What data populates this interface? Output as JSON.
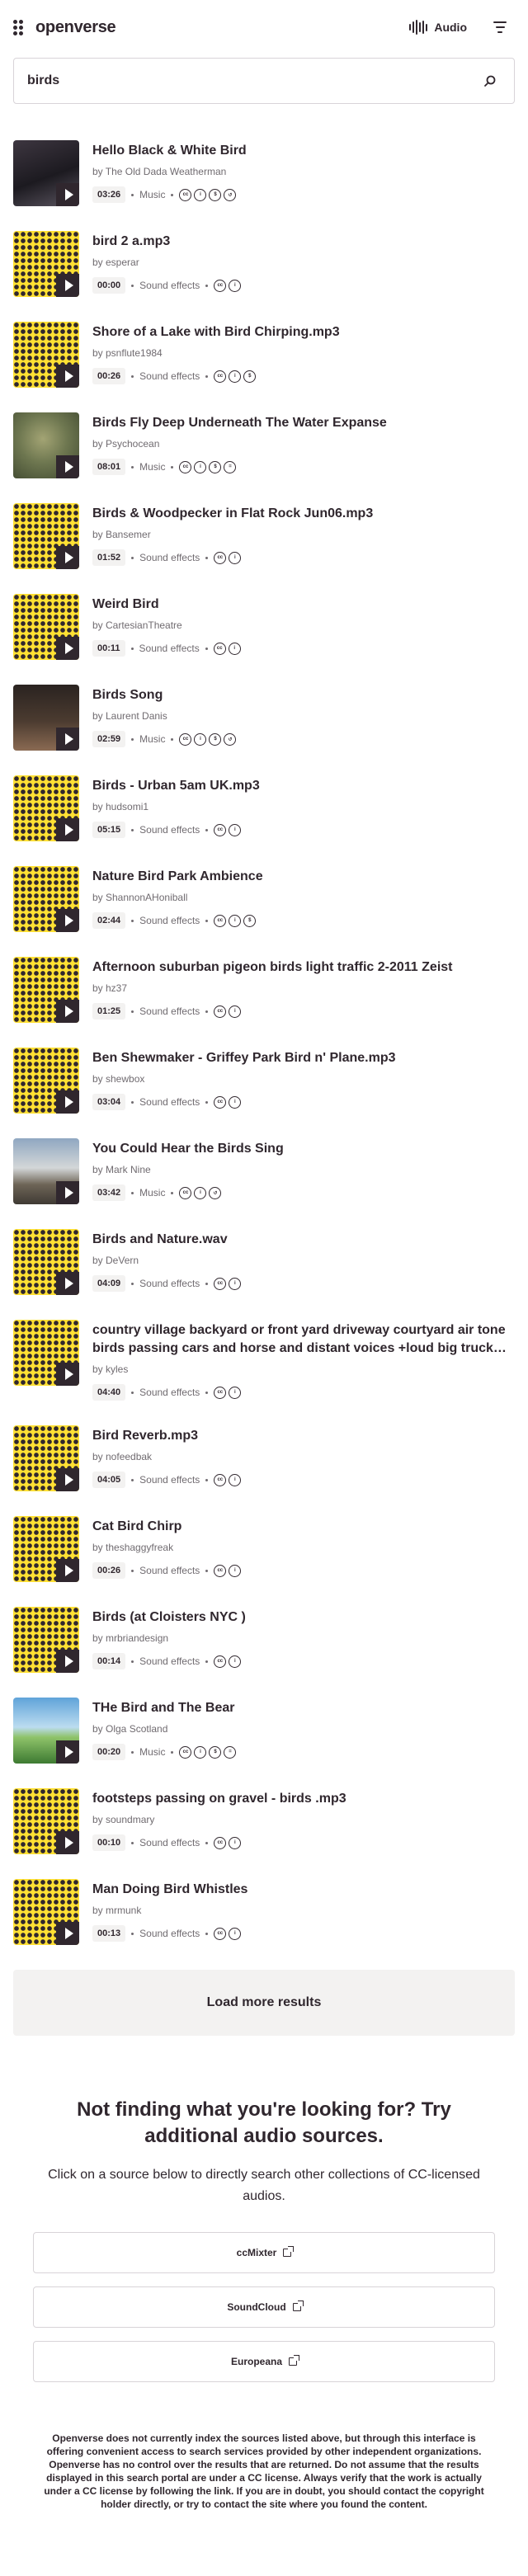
{
  "header": {
    "brand": "openverse",
    "content_type": "Audio"
  },
  "search": {
    "query": "birds"
  },
  "results": [
    {
      "title": "Hello Black & White Bird",
      "creator": "by The Old Dada Weatherman",
      "duration": "03:26",
      "category": "Music",
      "licenses": [
        "cc",
        "by",
        "nc",
        "sa"
      ],
      "thumb": "photo-dark"
    },
    {
      "title": "bird 2 a.mp3",
      "creator": "by esperar",
      "duration": "00:00",
      "category": "Sound effects",
      "licenses": [
        "cc",
        "by"
      ],
      "thumb": "pattern"
    },
    {
      "title": "Shore of a Lake with Bird Chirping.mp3",
      "creator": "by psnflute1984",
      "duration": "00:26",
      "category": "Sound effects",
      "licenses": [
        "cc",
        "by",
        "nc"
      ],
      "thumb": "pattern"
    },
    {
      "title": "Birds Fly Deep Underneath The Water Expanse",
      "creator": "by Psychocean",
      "duration": "08:01",
      "category": "Music",
      "licenses": [
        "cc",
        "by",
        "nc",
        "nd"
      ],
      "thumb": "photo-green"
    },
    {
      "title": "Birds & Woodpecker in Flat Rock Jun06.mp3",
      "creator": "by Bansemer",
      "duration": "01:52",
      "category": "Sound effects",
      "licenses": [
        "cc",
        "by"
      ],
      "thumb": "pattern"
    },
    {
      "title": "Weird Bird",
      "creator": "by CartesianTheatre",
      "duration": "00:11",
      "category": "Sound effects",
      "licenses": [
        "cc",
        "by"
      ],
      "thumb": "pattern"
    },
    {
      "title": "Birds Song",
      "creator": "by Laurent Danis",
      "duration": "02:59",
      "category": "Music",
      "licenses": [
        "cc",
        "by",
        "nc",
        "sa"
      ],
      "thumb": "photo-brown"
    },
    {
      "title": "Birds - Urban 5am UK.mp3",
      "creator": "by hudsomi1",
      "duration": "05:15",
      "category": "Sound effects",
      "licenses": [
        "cc",
        "by"
      ],
      "thumb": "pattern"
    },
    {
      "title": "Nature Bird Park Ambience",
      "creator": "by ShannonAHoniball",
      "duration": "02:44",
      "category": "Sound effects",
      "licenses": [
        "cc",
        "by",
        "nc"
      ],
      "thumb": "pattern"
    },
    {
      "title": "Afternoon suburban pigeon birds light traffic 2-2011 Zeist",
      "creator": "by hz37",
      "duration": "01:25",
      "category": "Sound effects",
      "licenses": [
        "cc",
        "by"
      ],
      "thumb": "pattern"
    },
    {
      "title": "Ben Shewmaker - Griffey Park Bird n' Plane.mp3",
      "creator": "by shewbox",
      "duration": "03:04",
      "category": "Sound effects",
      "licenses": [
        "cc",
        "by"
      ],
      "thumb": "pattern"
    },
    {
      "title": "You Could Hear the Birds Sing",
      "creator": "by Mark Nine",
      "duration": "03:42",
      "category": "Music",
      "licenses": [
        "cc",
        "by",
        "sa"
      ],
      "thumb": "photo-sky"
    },
    {
      "title": "Birds and Nature.wav",
      "creator": "by DeVern",
      "duration": "04:09",
      "category": "Sound effects",
      "licenses": [
        "cc",
        "by"
      ],
      "thumb": "pattern"
    },
    {
      "title": "country village backyard or front yard driveway courtyard air tone birds passing cars and horse and distant voices +loud big truck…",
      "creator": "by kyles",
      "duration": "04:40",
      "category": "Sound effects",
      "licenses": [
        "cc",
        "by"
      ],
      "thumb": "pattern",
      "tall": true
    },
    {
      "title": "Bird Reverb.mp3",
      "creator": "by nofeedbak",
      "duration": "04:05",
      "category": "Sound effects",
      "licenses": [
        "cc",
        "by"
      ],
      "thumb": "pattern"
    },
    {
      "title": "Cat Bird Chirp",
      "creator": "by theshaggyfreak",
      "duration": "00:26",
      "category": "Sound effects",
      "licenses": [
        "cc",
        "by"
      ],
      "thumb": "pattern"
    },
    {
      "title": "Birds (at Cloisters NYC )",
      "creator": "by mrbriandesign",
      "duration": "00:14",
      "category": "Sound effects",
      "licenses": [
        "cc",
        "by"
      ],
      "thumb": "pattern"
    },
    {
      "title": "THe Bird and The Bear",
      "creator": "by Olga Scotland",
      "duration": "00:20",
      "category": "Music",
      "licenses": [
        "cc",
        "by",
        "nc",
        "nd"
      ],
      "thumb": "photo-field"
    },
    {
      "title": "footsteps passing on gravel - birds .mp3",
      "creator": "by soundmary",
      "duration": "00:10",
      "category": "Sound effects",
      "licenses": [
        "cc",
        "by"
      ],
      "thumb": "pattern"
    },
    {
      "title": "Man Doing Bird Whistles",
      "creator": "by mrmunk",
      "duration": "00:13",
      "category": "Sound effects",
      "licenses": [
        "cc",
        "by"
      ],
      "thumb": "pattern"
    }
  ],
  "load_more": "Load more results",
  "external": {
    "title": "Not finding what you're looking for? Try additional audio sources.",
    "subtitle": "Click on a source below to directly search other collections of CC-licensed audios.",
    "sources": [
      "ccMixter",
      "SoundCloud",
      "Europeana"
    ],
    "disclaimer": "Openverse does not currently index the sources listed above, but through this interface is offering convenient access to search services provided by other independent organizations. Openverse has no control over the results that are returned. Do not assume that the results displayed in this search portal are under a CC license. Always verify that the work is actually under a CC license by following the link. If you are in doubt, you should contact the copyright holder directly, or try to contact the site where you found the content."
  },
  "colors": {
    "text": "#30272e",
    "muted": "#706b70",
    "yellow": "#ffe033",
    "tile": "#f3f2f1"
  }
}
